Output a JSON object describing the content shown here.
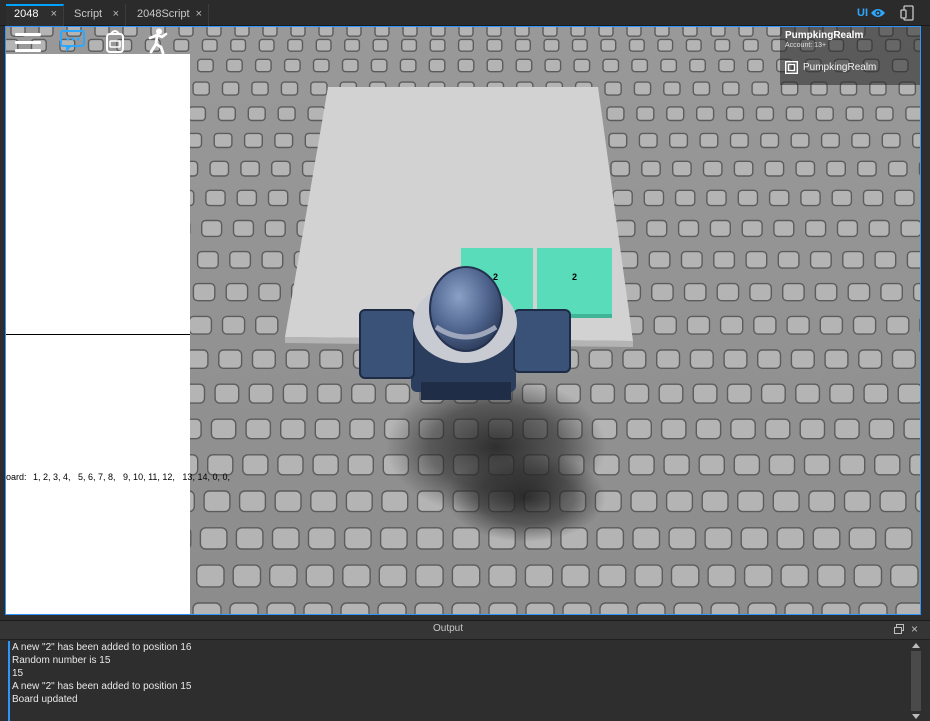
{
  "tabs": [
    {
      "label": "2048",
      "active": true
    },
    {
      "label": "Script",
      "active": false
    },
    {
      "label": "2048Script",
      "active": false
    }
  ],
  "tab_close_glyph": "×",
  "ui_toggle_label": "UI",
  "toolbar_icons": [
    "menu-icon",
    "chat-icon",
    "backpack-icon",
    "emote-icon"
  ],
  "account": {
    "name": "PumpkingRealm",
    "age": "Account: 13+",
    "row_name": "PumpkingRealm"
  },
  "gui": {
    "board_label": "oard:",
    "board_values": "1, 2, 3, 4,   5, 6, 7, 8,   9, 10, 11, 12,   13, 14, 0, 0,"
  },
  "tiles": [
    {
      "label": "2"
    },
    {
      "label": "2"
    }
  ],
  "output": {
    "title": "Output",
    "close_glyph": "×",
    "lines": [
      "A new \"2\" has been added to position 16",
      "Random number is 15",
      "15",
      "A new \"2\" has been added to position 15",
      "Board updated"
    ]
  },
  "colors": {
    "accent": "#2e95ff",
    "tile": "#55d9b6",
    "studs": "#7c7c7c",
    "baseplate": "#c9c9c9"
  }
}
